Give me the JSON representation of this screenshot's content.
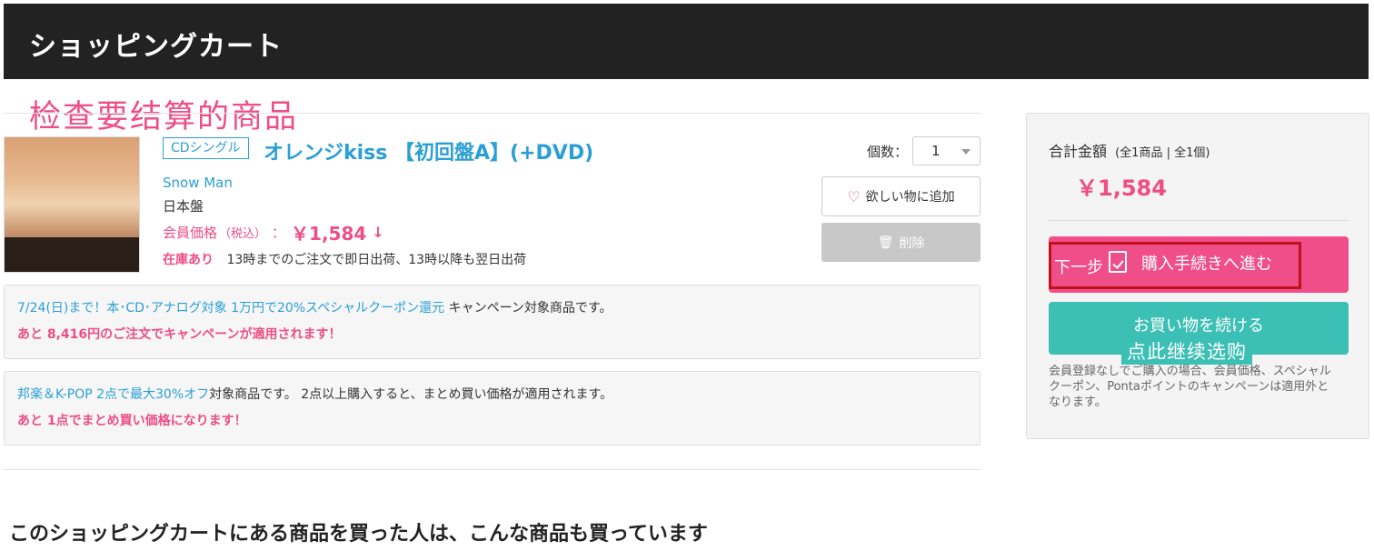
{
  "header": {
    "title": "ショッピングカート"
  },
  "annotations": {
    "top": "检查要结算的商品",
    "checkout": "下一步",
    "continue": "点此继续选购"
  },
  "product": {
    "tag": "CDシングル",
    "title": "オレンジkiss 【初回盤A】(+DVD)",
    "artist": "Snow Man",
    "edition": "日本盤",
    "price_label": "会員価格",
    "price_tax": "（税込）",
    "price_colon": "：",
    "price": "￥1,584",
    "stock": "在庫あり",
    "shipping": "13時までのご注文で即日出荷、13時以降も翌日出荷",
    "qty_label": "個数：",
    "qty_value": "1",
    "wish_label": "欲しい物に追加",
    "delete_label": "削除"
  },
  "campaigns": [
    {
      "link": "7/24(日)まで！本･CD･アナログ対象 1万円で20%スペシャルクーポン還元",
      "text": " キャンペーン対象商品です。",
      "note": "あと 8,416円のご注文でキャンペーンが適用されます！"
    },
    {
      "link": "邦楽＆K-POP 2点で最大30%オフ",
      "text": "対象商品です。 2点以上購入すると、まとめ買い価格が適用されます。",
      "note": "あと 1点でまとめ買い価格になります！"
    }
  ],
  "sidebar": {
    "total_label": "合計金額",
    "total_detail": "(全1商品 | 全1個)",
    "total_value": "￥1,584",
    "checkout_label": "購入手続きへ進む",
    "continue_label": "お買い物を続ける",
    "note": "会員登録なしでご購入の場合、会員価格、スペシャルクーポン、Pontaポイントのキャンペーンは適用外となります。"
  },
  "recommend": {
    "title": "このショッピングカートにある商品を買った人は、こんな商品も買っています"
  },
  "colors": {
    "accent_pink": "#ee4e84",
    "link_blue": "#2a9fd6",
    "teal": "#3cbfb4",
    "header_bg": "#222222"
  }
}
